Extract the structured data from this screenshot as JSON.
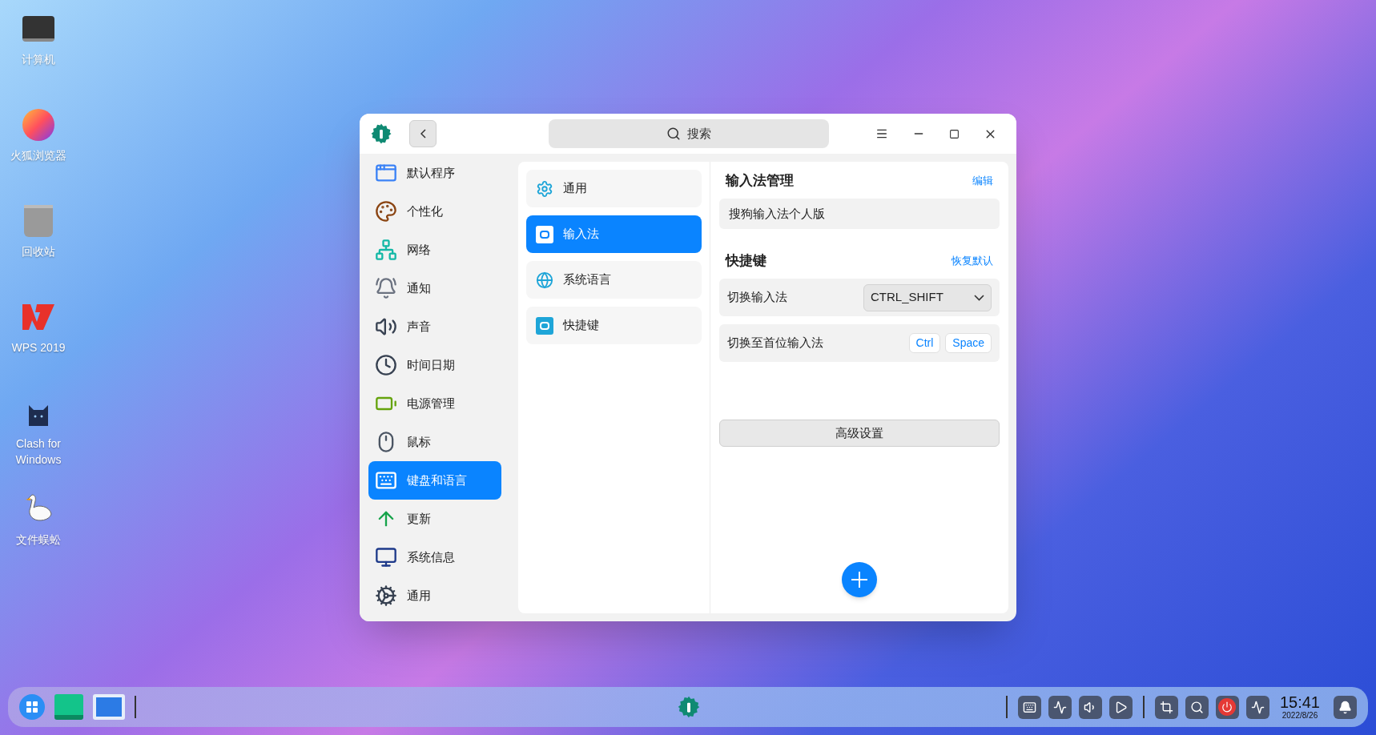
{
  "desktop_icons": [
    {
      "label": "计算机"
    },
    {
      "label": "火狐浏览器"
    },
    {
      "label": "回收站"
    },
    {
      "label": "WPS 2019"
    },
    {
      "label": "Clash for Windows"
    },
    {
      "label": "文件蜈蚣"
    }
  ],
  "window": {
    "search_placeholder": "搜索",
    "sidebar": [
      {
        "label": "默认程序",
        "selected": false
      },
      {
        "label": "个性化",
        "selected": false
      },
      {
        "label": "网络",
        "selected": false
      },
      {
        "label": "通知",
        "selected": false
      },
      {
        "label": "声音",
        "selected": false
      },
      {
        "label": "时间日期",
        "selected": false
      },
      {
        "label": "电源管理",
        "selected": false
      },
      {
        "label": "鼠标",
        "selected": false
      },
      {
        "label": "键盘和语言",
        "selected": true
      },
      {
        "label": "更新",
        "selected": false
      },
      {
        "label": "系统信息",
        "selected": false
      },
      {
        "label": "通用",
        "selected": false
      }
    ],
    "categories": [
      {
        "label": "通用",
        "selected": false
      },
      {
        "label": "输入法",
        "selected": true
      },
      {
        "label": "系统语言",
        "selected": false
      },
      {
        "label": "快捷键",
        "selected": false
      }
    ],
    "input_methods": {
      "title": "输入法管理",
      "action": "编辑",
      "items": [
        "搜狗输入法个人版"
      ]
    },
    "shortcuts": {
      "title": "快捷键",
      "action": "恢复默认",
      "rows": [
        {
          "kind": "select",
          "label": "切换输入法",
          "value": "CTRL_SHIFT"
        },
        {
          "kind": "keys",
          "label": "切换至首位输入法",
          "keys": [
            "Ctrl",
            "Space"
          ]
        }
      ]
    },
    "advanced_button": "高级设置"
  },
  "taskbar": {
    "time": "15:41",
    "date": "2022/8/26"
  }
}
